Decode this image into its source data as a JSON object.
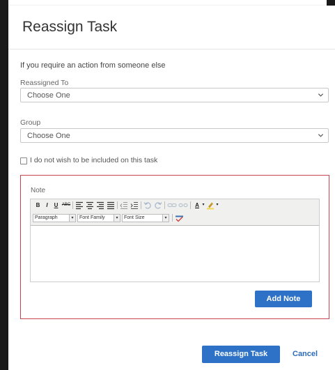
{
  "dialog": {
    "title": "Reassign Task",
    "intro": "If you require an action from someone else",
    "reassigned_to": {
      "label": "Reassigned To",
      "value": "Choose One"
    },
    "group": {
      "label": "Group",
      "value": "Choose One"
    },
    "exclude_checkbox": {
      "label": "I do not wish to be included on this task",
      "checked": false
    },
    "note": {
      "label": "Note",
      "editor": {
        "paragraph": "Paragraph",
        "font_family": "Font Family",
        "font_size": "Font Size",
        "bold": "B",
        "italic": "I",
        "underline": "U",
        "strike": "ABC",
        "text_color": "A",
        "content": ""
      },
      "add_button": "Add Note"
    },
    "actions": {
      "primary": "Reassign Task",
      "cancel": "Cancel"
    }
  },
  "colors": {
    "accent": "#2d72c6",
    "note_border": "#c9434f"
  }
}
